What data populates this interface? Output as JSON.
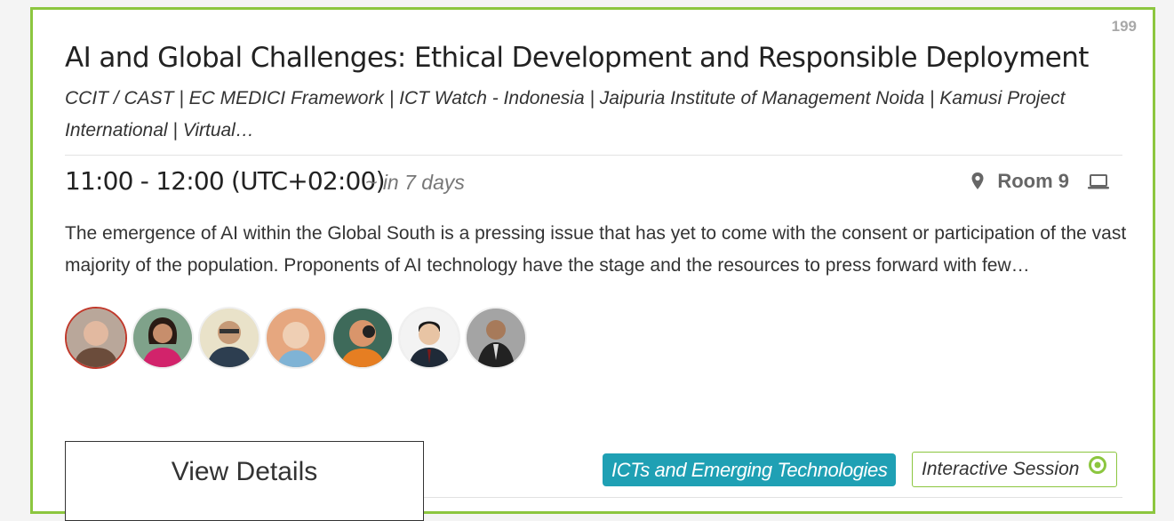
{
  "card": {
    "number": "199",
    "title": "AI and Global Challenges: Ethical Development and Responsible Deployment",
    "organizers": "CCIT / CAST | EC MEDICI Framework | ICT Watch - Indonesia | Jaipuria Institute of Management Noida | Kamusi Project International | Virtual…",
    "time": "11:00 - 12:00 (UTC+02:00)",
    "relative_time": "~ in 7 days",
    "room": "Room 9",
    "location_icon": "map-pin-icon",
    "online_icon": "laptop-icon",
    "description": "The emergence of AI within the Global South is a pressing issue that has yet to come with the consent or participation of the vast majority of the population. Proponents of AI technology have the stage and the resources to press forward with few…",
    "speakers_count": 7,
    "view_details_label": "View Details",
    "topic_tag": "ICTs and Emerging Technologies",
    "session_type": "Interactive Session",
    "session_icon": "target-circle-icon"
  },
  "colors": {
    "card_border": "#8cc63f",
    "topic_badge_bg": "#1fa0b4",
    "session_badge_border": "#8cc63f",
    "highlighted_avatar_border": "#c0392b",
    "card_number": "#a8a8a8"
  }
}
